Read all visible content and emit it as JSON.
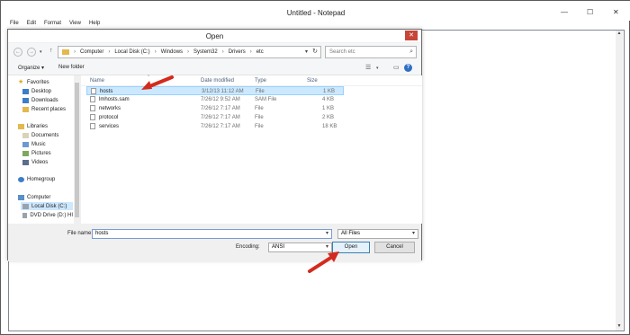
{
  "notepad": {
    "title": "Untitled - Notepad",
    "window_buttons": {
      "minimize": "—",
      "maximize": "☐",
      "close": "✕"
    },
    "menu": [
      "File",
      "Edit",
      "Format",
      "View",
      "Help"
    ]
  },
  "dialog": {
    "title": "Open",
    "close_glyph": "✕",
    "nav": {
      "back": "←",
      "forward": "→",
      "dropdown": "▾",
      "up": "↑"
    },
    "breadcrumb": [
      "Computer",
      "Local Disk (C:)",
      "Windows",
      "System32",
      "Drivers",
      "etc"
    ],
    "breadcrumb_sep": "›",
    "search_placeholder": "Search etc",
    "toolbar": {
      "organize": "Organize ▾",
      "new_folder": "New folder",
      "help": "?"
    },
    "tree": [
      {
        "label": "Favorites",
        "level": 0,
        "icon": "star-icon"
      },
      {
        "label": "Desktop",
        "level": 1,
        "icon": "desktop-icon"
      },
      {
        "label": "Downloads",
        "level": 1,
        "icon": "downloads-icon"
      },
      {
        "label": "Recent places",
        "level": 1,
        "icon": "recent-places-icon"
      },
      {
        "label": "Libraries",
        "level": 0,
        "icon": "libraries-icon"
      },
      {
        "label": "Documents",
        "level": 1,
        "icon": "documents-icon"
      },
      {
        "label": "Music",
        "level": 1,
        "icon": "music-icon"
      },
      {
        "label": "Pictures",
        "level": 1,
        "icon": "pictures-icon"
      },
      {
        "label": "Videos",
        "level": 1,
        "icon": "videos-icon"
      },
      {
        "label": "Homegroup",
        "level": 0,
        "icon": "homegroup-icon"
      },
      {
        "label": "Computer",
        "level": 0,
        "icon": "computer-icon"
      },
      {
        "label": "Local Disk (C:)",
        "level": 1,
        "icon": "drive-icon"
      },
      {
        "label": "DVD Drive (D:) HI",
        "level": 1,
        "icon": "dvd-drive-icon"
      }
    ],
    "columns": [
      "Name",
      "Date modified",
      "Type",
      "Size"
    ],
    "files": [
      {
        "name": "hosts",
        "date": "3/12/13 11:12 AM",
        "type": "File",
        "size": "1 KB",
        "selected": true
      },
      {
        "name": "lmhosts.sam",
        "date": "7/26/12 9:52 AM",
        "type": "SAM File",
        "size": "4 KB",
        "selected": false
      },
      {
        "name": "networks",
        "date": "7/26/12 7:17 AM",
        "type": "File",
        "size": "1 KB",
        "selected": false
      },
      {
        "name": "protocol",
        "date": "7/26/12 7:17 AM",
        "type": "File",
        "size": "2 KB",
        "selected": false
      },
      {
        "name": "services",
        "date": "7/26/12 7:17 AM",
        "type": "File",
        "size": "18 KB",
        "selected": false
      }
    ],
    "file_name_label": "File name:",
    "file_name_value": "hosts",
    "file_type_value": "All Files",
    "encoding_label": "Encoding:",
    "encoding_value": "ANSI",
    "open_button": "Open",
    "cancel_button": "Cancel"
  },
  "colors": {
    "arrow": "#d42a1e",
    "selection": "#cce8ff",
    "close": "#c7463a"
  }
}
